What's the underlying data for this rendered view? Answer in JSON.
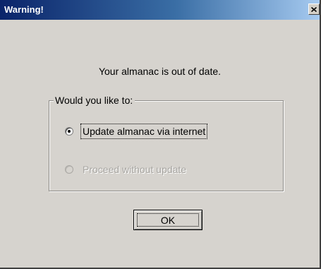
{
  "window": {
    "title": "Warning!"
  },
  "icons": {
    "close": "close-icon"
  },
  "message": "Your almanac is out of date.",
  "group": {
    "label": "Would you like to:",
    "options": [
      {
        "label": "Update almanac via internet",
        "selected": true,
        "enabled": true
      },
      {
        "label": "Proceed without update",
        "selected": false,
        "enabled": false
      }
    ]
  },
  "buttons": {
    "ok": "OK"
  },
  "colors": {
    "title_gradient_start": "#0a246a",
    "title_gradient_end": "#a6caf0",
    "dialog_background": "#d6d3ce",
    "disabled_text": "#a7a5a1"
  }
}
